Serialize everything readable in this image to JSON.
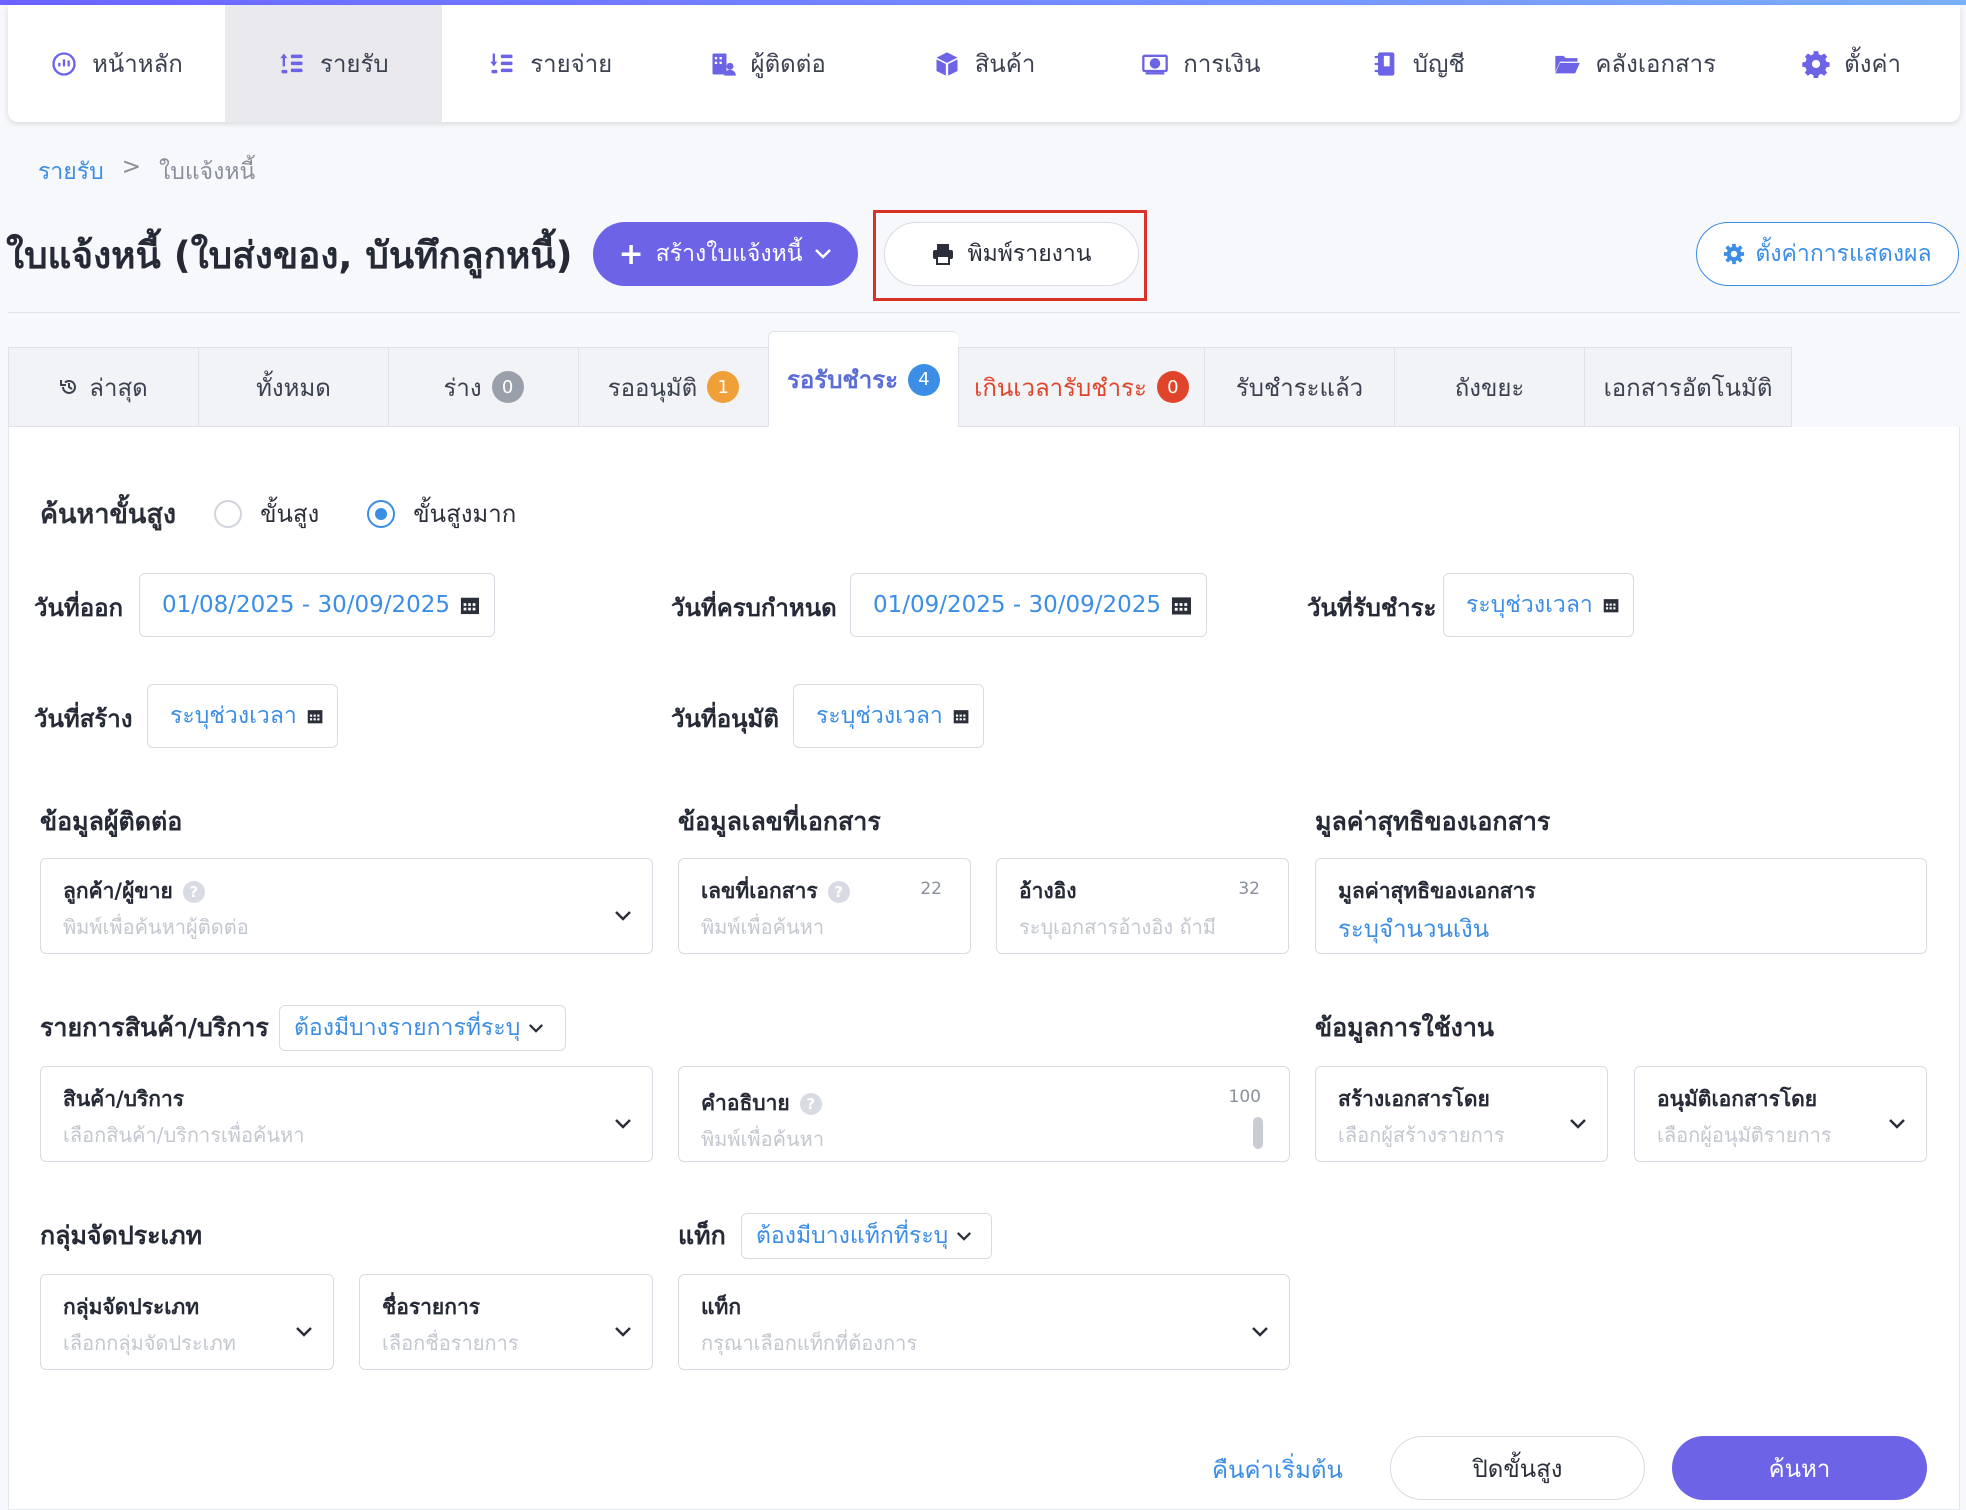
{
  "nav": {
    "items": [
      {
        "label": "หน้าหลัก",
        "icon": "dashboard-icon"
      },
      {
        "label": "รายรับ",
        "icon": "income-icon",
        "active": true
      },
      {
        "label": "รายจ่าย",
        "icon": "expense-icon"
      },
      {
        "label": "ผู้ติดต่อ",
        "icon": "contacts-icon"
      },
      {
        "label": "สินค้า",
        "icon": "box-icon"
      },
      {
        "label": "การเงิน",
        "icon": "money-icon"
      },
      {
        "label": "บัญชี",
        "icon": "ledger-icon"
      },
      {
        "label": "คลังเอกสาร",
        "icon": "folder-icon"
      },
      {
        "label": "ตั้งค่า",
        "icon": "gear-icon"
      }
    ]
  },
  "breadcrumb": {
    "parent": "รายรับ",
    "separator": ">",
    "current": "ใบแจ้งหนี้"
  },
  "header": {
    "title": "ใบแจ้งหนี้ (ใบส่งของ, บันทึกลูกหนี้)",
    "create_label": "สร้างใบแจ้งหนี้",
    "print_label": "พิมพ์รายงาน",
    "settings_label": "ตั้งค่าการแสดงผล"
  },
  "tabs": [
    {
      "label": "ล่าสุด",
      "icon": "history-icon"
    },
    {
      "label": "ทั้งหมด"
    },
    {
      "label": "ร่าง",
      "badge": "0",
      "badge_color": "gray"
    },
    {
      "label": "รออนุมัติ",
      "badge": "1",
      "badge_color": "orange"
    },
    {
      "label": "รอรับชำระ",
      "badge": "4",
      "badge_color": "blue",
      "active": true
    },
    {
      "label": "เกินเวลารับชำระ",
      "badge": "0",
      "badge_color": "red"
    },
    {
      "label": "รับชำระแล้ว"
    },
    {
      "label": "ถังขยะ"
    },
    {
      "label": "เอกสารอัตโนมัติ"
    }
  ],
  "search": {
    "title": "ค้นหาขั้นสูง",
    "option_advanced": "ขั้นสูง",
    "option_very_advanced": "ขั้นสูงมาก",
    "selected": "ขั้นสูงมาก"
  },
  "dates": {
    "issue_label": "วันที่ออก",
    "issue_value": "01/08/2025 - 30/09/2025",
    "due_label": "วันที่ครบกำหนด",
    "due_value": "01/09/2025 - 30/09/2025",
    "paid_label": "วันที่รับชำระ",
    "paid_value": "ระบุช่วงเวลา",
    "created_label": "วันที่สร้าง",
    "created_value": "ระบุช่วงเวลา",
    "approved_label": "วันที่อนุมัติ",
    "approved_value": "ระบุช่วงเวลา"
  },
  "contact": {
    "section": "ข้อมูลผู้ติดต่อ",
    "label": "ลูกค้า/ผู้ขาย",
    "placeholder": "พิมพ์เพื่อค้นหาผู้ติดต่อ"
  },
  "docnum": {
    "section": "ข้อมูลเลขที่เอกสาร",
    "number_label": "เลขที่เอกสาร",
    "number_count": "22",
    "number_placeholder": "พิมพ์เพื่อค้นหา",
    "ref_label": "อ้างอิง",
    "ref_count": "32",
    "ref_placeholder": "ระบุเอกสารอ้างอิง ถ้ามี"
  },
  "netvalue": {
    "section": "มูลค่าสุทธิของเอกสาร",
    "label": "มูลค่าสุทธิของเอกสาร",
    "value": "ระบุจำนวนเงิน"
  },
  "products": {
    "section": "รายการสินค้า/บริการ",
    "mode": "ต้องมีบางรายการที่ระบุ",
    "label": "สินค้า/บริการ",
    "placeholder": "เลือกสินค้า/บริการเพื่อค้นหา"
  },
  "description": {
    "label": "คำอธิบาย",
    "count": "100",
    "placeholder": "พิมพ์เพื่อค้นหา"
  },
  "usage": {
    "section": "ข้อมูลการใช้งาน",
    "created_by_label": "สร้างเอกสารโดย",
    "created_by_placeholder": "เลือกผู้สร้างรายการ",
    "approved_by_label": "อนุมัติเอกสารโดย",
    "approved_by_placeholder": "เลือกผู้อนุมัติรายการ"
  },
  "category": {
    "section": "กลุ่มจัดประเภท",
    "group_label": "กลุ่มจัดประเภท",
    "group_placeholder": "เลือกกลุ่มจัดประเภท",
    "name_label": "ชื่อรายการ",
    "name_placeholder": "เลือกชื่อรายการ"
  },
  "tags": {
    "section": "แท็ก",
    "mode": "ต้องมีบางแท็กที่ระบุ",
    "label": "แท็ก",
    "placeholder": "กรุณาเลือกแท็กที่ต้องการ"
  },
  "actions": {
    "reset": "คืนค่าเริ่มต้น",
    "close_advanced": "ปิดขั้นสูง",
    "search": "ค้นหา"
  },
  "colors": {
    "primary": "#6c63e6",
    "link": "#3b8de6",
    "highlight": "#d9322b",
    "overdue": "#e0452b"
  }
}
